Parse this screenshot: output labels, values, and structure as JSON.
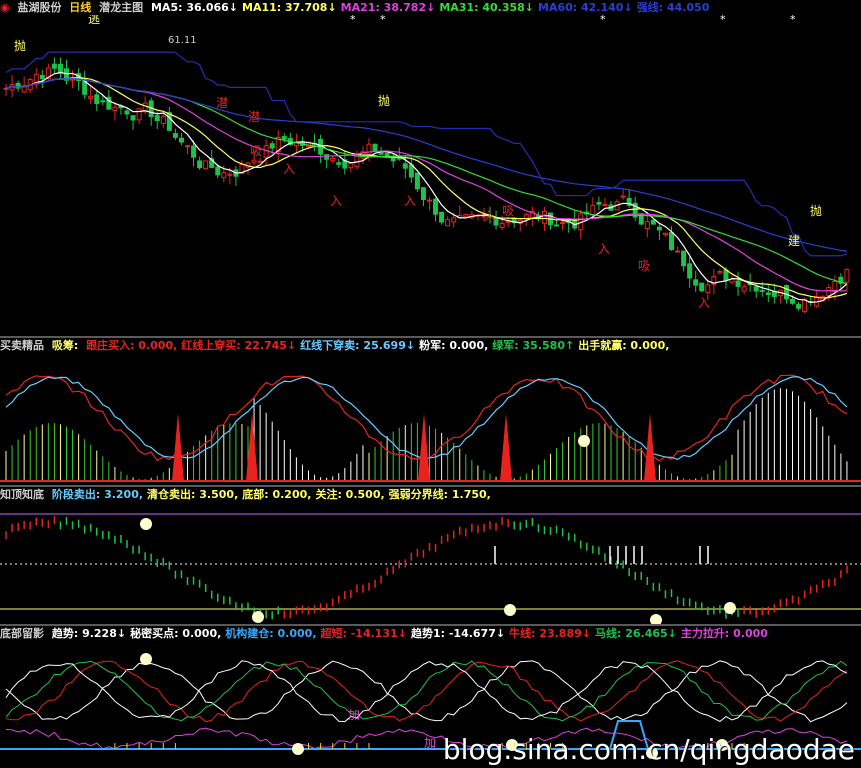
{
  "colors": {
    "up": "#e8231f",
    "down": "#1ec24a",
    "ma5": "#ffffff",
    "ma11": "#ffff66",
    "ma21": "#e040e0",
    "ma31": "#33dd33",
    "ma60": "#2a3fd0"
  },
  "main": {
    "stock": "盐湖股份",
    "period": "日线",
    "template": "潜龙主图",
    "ma": [
      {
        "label": "MA5: ",
        "value": "36.066",
        "arrow": "↓",
        "color": "#ffffff"
      },
      {
        "label": "MA11: ",
        "value": "37.708",
        "arrow": "↓",
        "color": "#ffff66"
      },
      {
        "label": "MA21: ",
        "value": "38.782",
        "arrow": "↓",
        "color": "#e040e0"
      },
      {
        "label": "MA31: ",
        "value": "40.358",
        "arrow": "↓",
        "color": "#33dd33"
      },
      {
        "label": "MA60: ",
        "value": "42.140",
        "arrow": "↓",
        "color": "#2a3fd0"
      },
      {
        "label": "强线: ",
        "value": "44.050",
        "arrow": "",
        "color": "#2a3fd0"
      }
    ],
    "high_marker": "61.11",
    "annotations": {
      "escape": "逃",
      "throw": "抛",
      "latent": "潜",
      "absorb": "吸",
      "enter": "入",
      "build": "建",
      "star": "*"
    }
  },
  "panel2": {
    "name": "买卖精品",
    "items": [
      {
        "label": "吸筹: ",
        "value": "",
        "color": "#ffff66"
      },
      {
        "label": "跟庄买入: ",
        "value": "0.000",
        "arrow": ",",
        "color": "#e8231f"
      },
      {
        "label": "红线上穿买: ",
        "value": "22.745",
        "arrow": "↓",
        "color": "#e8231f"
      },
      {
        "label": "红线下穿卖: ",
        "value": "25.699",
        "arrow": "↓",
        "color": "#66ccff"
      },
      {
        "label": "粉军: ",
        "value": "0.000",
        "arrow": ",",
        "color": "#ffffff"
      },
      {
        "label": "绿军: ",
        "value": "35.580",
        "arrow": "↑",
        "color": "#1ec24a"
      },
      {
        "label": "出手就赢: ",
        "value": "0.000",
        "arrow": ",",
        "color": "#ffff66"
      }
    ]
  },
  "panel3": {
    "name": "知顶知底",
    "items": [
      {
        "label": "阶段卖出: ",
        "value": "3.200",
        "arrow": ",",
        "color": "#66ccff"
      },
      {
        "label": "清仓卖出: ",
        "value": "3.500",
        "arrow": ",",
        "color": "#ffff66"
      },
      {
        "label": "底部: ",
        "value": "0.200",
        "arrow": ",",
        "color": "#ffff66"
      },
      {
        "label": "关注: ",
        "value": "0.500",
        "arrow": ",",
        "color": "#ffff66"
      },
      {
        "label": "强弱分界线: ",
        "value": "1.750",
        "arrow": ",",
        "color": "#ffff66"
      }
    ]
  },
  "panel4": {
    "name": "底部留影",
    "items": [
      {
        "label": "趋势: ",
        "value": "9.228",
        "arrow": "↓",
        "color": "#ffffff"
      },
      {
        "label": "秘密买点: ",
        "value": "0.000",
        "arrow": ",",
        "color": "#ffffff"
      },
      {
        "label": "机构建仓: ",
        "value": "0.000",
        "arrow": ",",
        "color": "#33aaff"
      },
      {
        "label": "超短: ",
        "value": "-14.131",
        "arrow": "↓",
        "color": "#e8231f"
      },
      {
        "label": "趋势1: ",
        "value": "-14.677",
        "arrow": "↓",
        "color": "#ffffff"
      },
      {
        "label": "牛线: ",
        "value": "23.889",
        "arrow": "↓",
        "color": "#e8231f"
      },
      {
        "label": "马线: ",
        "value": "26.465",
        "arrow": "↓",
        "color": "#1ec24a"
      },
      {
        "label": "主力拉升: ",
        "value": "0.000",
        "arrow": "",
        "color": "#e040e0"
      }
    ],
    "add_label": "加"
  },
  "watermark": "blog.sina.com.cn/qingdaodae",
  "chart_data": [
    {
      "type": "candlestick",
      "title": "盐湖股份 日线",
      "series": [
        {
          "name": "MA5",
          "value": 36.066
        },
        {
          "name": "MA11",
          "value": 37.708
        },
        {
          "name": "MA21",
          "value": 38.782
        },
        {
          "name": "MA31",
          "value": 40.358
        },
        {
          "name": "MA60",
          "value": 42.14
        },
        {
          "name": "强线",
          "value": 44.05
        }
      ],
      "annotations": [
        "61.11"
      ]
    },
    {
      "type": "line",
      "title": "买卖精品"
    },
    {
      "type": "line",
      "title": "知顶知底",
      "series": [
        {
          "name": "阶段卖出",
          "value": 3.2
        },
        {
          "name": "清仓卖出",
          "value": 3.5
        },
        {
          "name": "底部",
          "value": 0.2
        },
        {
          "name": "关注",
          "value": 0.5
        },
        {
          "name": "强弱分界线",
          "value": 1.75
        }
      ]
    },
    {
      "type": "line",
      "title": "底部留影"
    }
  ]
}
